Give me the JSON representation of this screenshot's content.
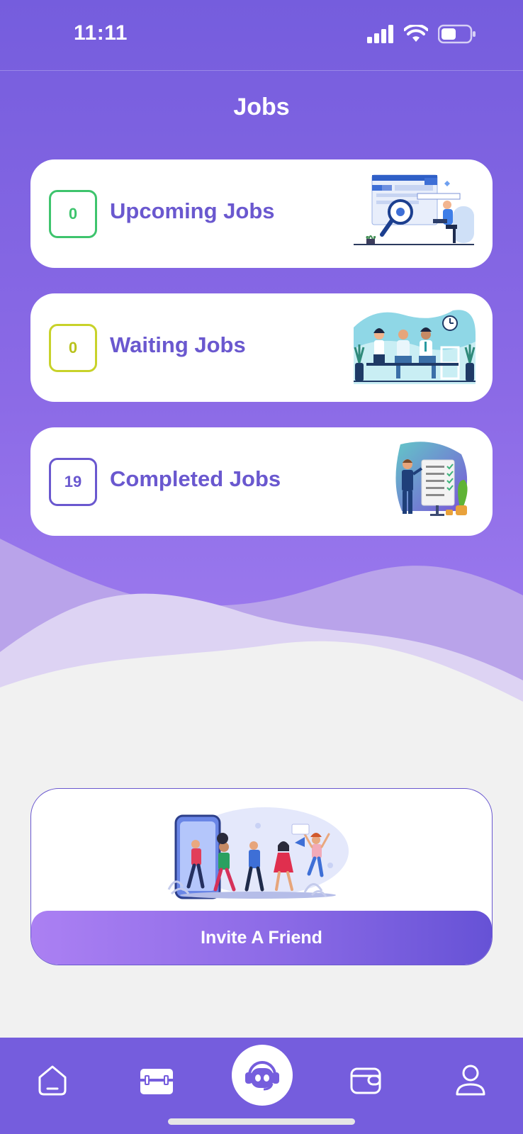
{
  "status_bar": {
    "time": "11:11"
  },
  "header": {
    "title": "Jobs"
  },
  "job_cards": [
    {
      "count": "0",
      "label": "Upcoming Jobs",
      "border_color": "#3ec46d",
      "count_color": "#3ec46d",
      "illustration": "job-search-illustration"
    },
    {
      "count": "0",
      "label": "Waiting Jobs",
      "border_color": "#c8d22a",
      "count_color": "#b9c21c",
      "illustration": "waiting-room-illustration"
    },
    {
      "count": "19",
      "label": "Completed Jobs",
      "border_color": "#6a58cf",
      "count_color": "#6a58cf",
      "illustration": "checklist-presentation-illustration"
    }
  ],
  "invite": {
    "button_label": "Invite A Friend",
    "illustration": "friends-leaving-phone-illustration"
  },
  "bottom_nav": {
    "items": [
      {
        "icon": "home-icon"
      },
      {
        "icon": "briefcase-icon"
      },
      {
        "icon": "support-bot-icon"
      },
      {
        "icon": "wallet-icon"
      },
      {
        "icon": "profile-icon"
      }
    ]
  },
  "colors": {
    "primary": "#755ddd",
    "accent": "#6a58cf",
    "background": "#f1f1f1"
  }
}
